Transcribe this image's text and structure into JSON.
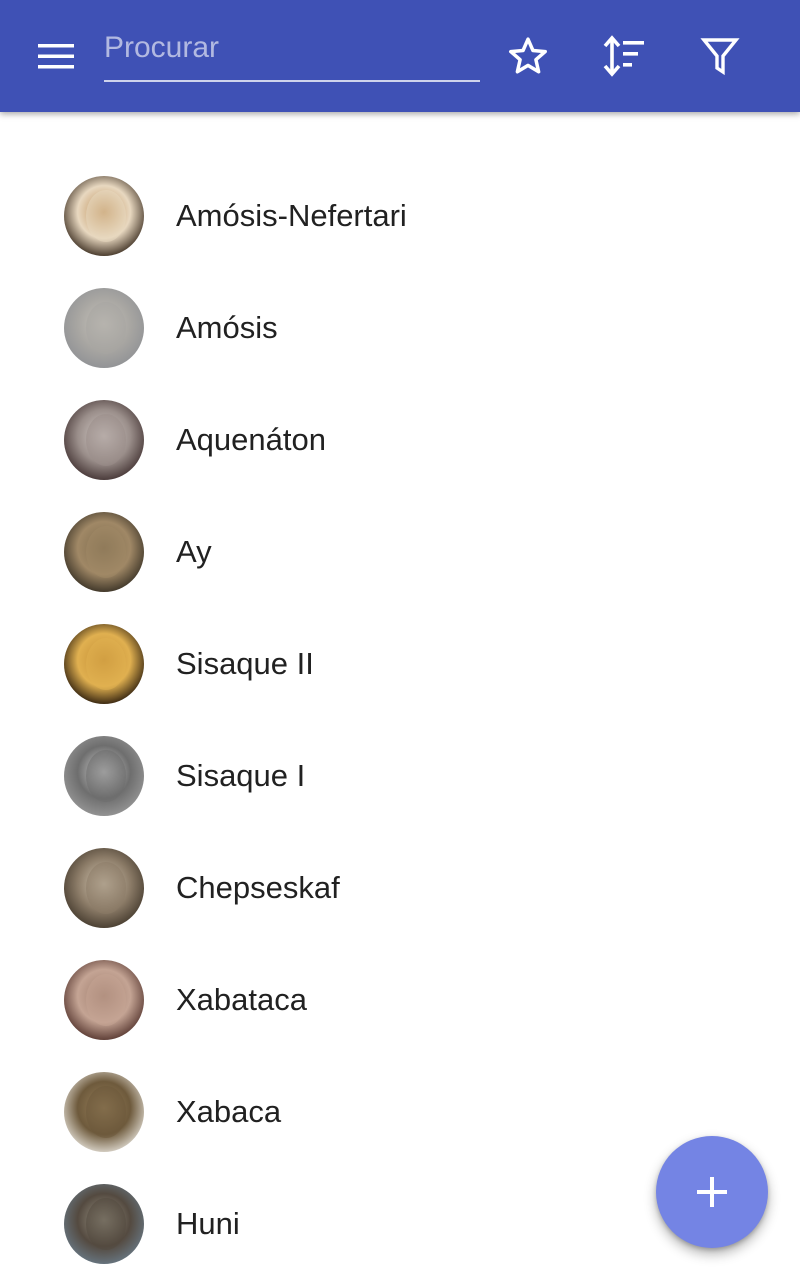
{
  "colors": {
    "app_bar": "#3f51b5",
    "fab": "#7484e4",
    "text": "#212121",
    "icon": "#ffffff"
  },
  "toolbar": {
    "menu_icon": "menu-icon",
    "search": {
      "placeholder": "Procurar",
      "value": ""
    },
    "favorites_icon": "star-outline-icon",
    "sort_icon": "sort-icon",
    "filter_icon": "filter-icon"
  },
  "items": [
    {
      "name": "Amósis-Nefertari",
      "avatar_colors": [
        "#2a1c10",
        "#b8864a",
        "#e8d8c0"
      ]
    },
    {
      "name": "Amósis",
      "avatar_colors": [
        "#8e9094",
        "#c8c4bc",
        "#a8a6a2"
      ]
    },
    {
      "name": "Aquenáton",
      "avatar_colors": [
        "#3a2a2a",
        "#d8d0cc",
        "#9a8e8a"
      ]
    },
    {
      "name": "Ay",
      "avatar_colors": [
        "#2e281e",
        "#7c6a4c",
        "#a08866"
      ]
    },
    {
      "name": "Sisaque II",
      "avatar_colors": [
        "#1a0e06",
        "#c08a32",
        "#e0b050"
      ]
    },
    {
      "name": "Sisaque I",
      "avatar_colors": [
        "#9a9a9a",
        "#d6d6d6",
        "#6e6e6e"
      ]
    },
    {
      "name": "Chepseskaf",
      "avatar_colors": [
        "#3e3428",
        "#d8ccb8",
        "#8c7c68"
      ]
    },
    {
      "name": "Xabataca",
      "avatar_colors": [
        "#4a2a24",
        "#9c7a6a",
        "#c4a494"
      ]
    },
    {
      "name": "Xabaca",
      "avatar_colors": [
        "#e8e4dc",
        "#9c845e",
        "#6e5a3c"
      ]
    },
    {
      "name": "Huni",
      "avatar_colors": [
        "#6a7c8a",
        "#a09a8a",
        "#544a40"
      ]
    }
  ],
  "fab": {
    "icon": "add-icon"
  }
}
